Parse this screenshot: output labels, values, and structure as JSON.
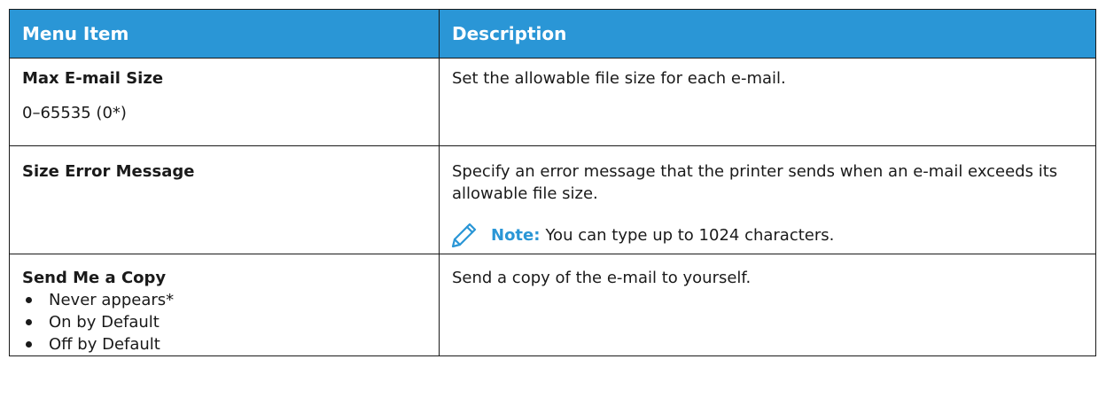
{
  "header": {
    "col1": "Menu Item",
    "col2": "Description"
  },
  "rows": [
    {
      "name": "Max E-mail Size",
      "value": "0–65535 (0*)",
      "description": "Set the allowable file size for each e-mail."
    },
    {
      "name": "Size Error Message",
      "description": "Specify an error message that the printer sends when an e-mail exceeds its allowable file size.",
      "note_label": "Note:",
      "note_text": "You can type up to 1024 characters."
    },
    {
      "name": "Send Me a Copy",
      "options": [
        "Never appears*",
        "On by Default",
        "Off by Default"
      ],
      "description": "Send a copy of the e-mail to yourself."
    }
  ],
  "colors": {
    "header_bg": "#2a96d6",
    "note_accent": "#2a96d6"
  },
  "icons": {
    "note": "pencil-icon"
  }
}
